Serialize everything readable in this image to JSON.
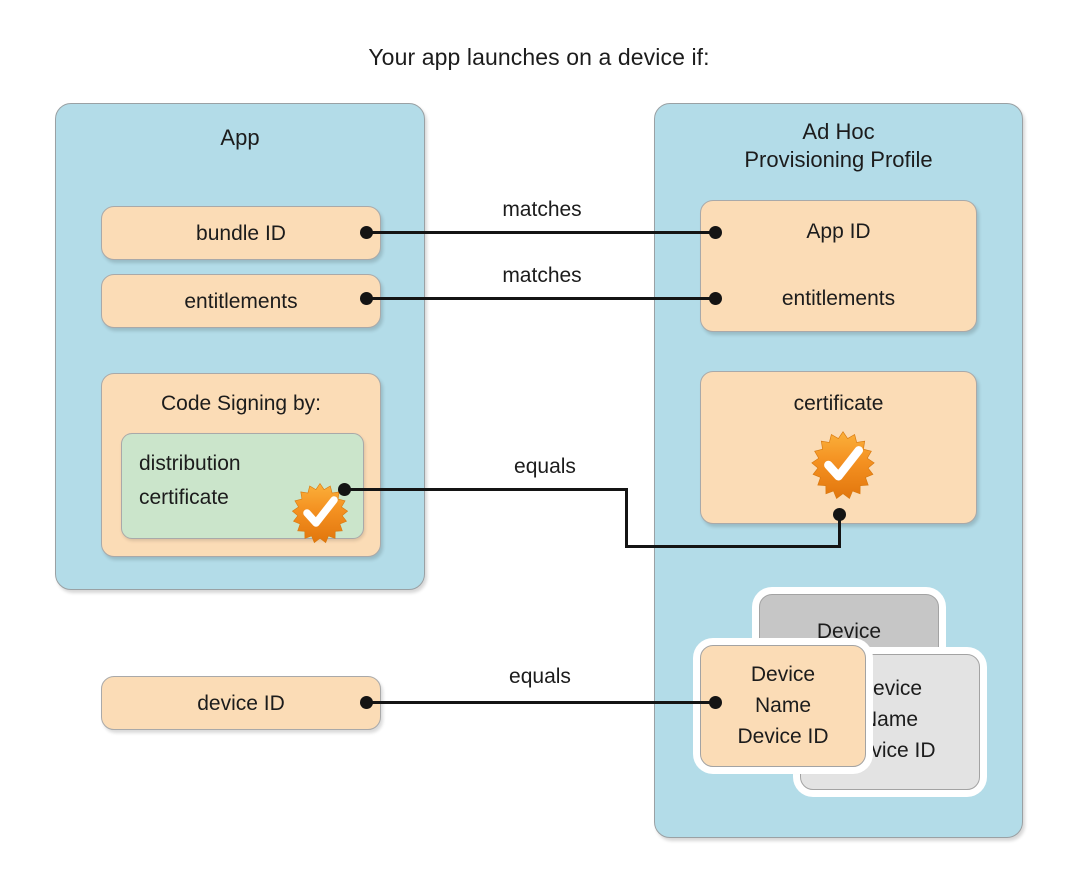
{
  "title": "Your app launches on a device if:",
  "colors": {
    "panel_blue": "#b3dce8",
    "box_peach": "#fbdcb6",
    "box_green": "#cbe5cb",
    "card_gray_back": "#c6c6c6",
    "card_gray_mid": "#e3e3e3",
    "seal_orange": "#f2991e",
    "line_black": "#141414",
    "text": "#1c1c1c",
    "background": "#ffffff"
  },
  "app_panel": {
    "title": "App",
    "bundle_id": "bundle ID",
    "entitlements": "entitlements",
    "code_signing_heading": "Code Signing by:",
    "distribution_line1": "distribution",
    "distribution_line2": "certificate",
    "seal_icon": "certificate-seal-icon"
  },
  "profile_panel": {
    "title_line1": "Ad Hoc",
    "title_line2": "Provisioning Profile",
    "app_id": "App ID",
    "entitlements": "entitlements",
    "certificate": "certificate",
    "seal_icon": "certificate-seal-icon",
    "devices": [
      {
        "id": "back",
        "text": "Device"
      },
      {
        "id": "mid",
        "line1": "Device",
        "line2": "Name",
        "line3": "Device ID"
      },
      {
        "id": "front",
        "line1": "Device",
        "line2": "Name",
        "line3": "Device ID"
      }
    ]
  },
  "standalone": {
    "device_id": "device ID"
  },
  "connectors": [
    {
      "id": "bundle-appid",
      "label": "matches"
    },
    {
      "id": "entitle-entitle",
      "label": "matches"
    },
    {
      "id": "cert-cert",
      "label": "equals"
    },
    {
      "id": "deviceid-device",
      "label": "equals"
    }
  ]
}
